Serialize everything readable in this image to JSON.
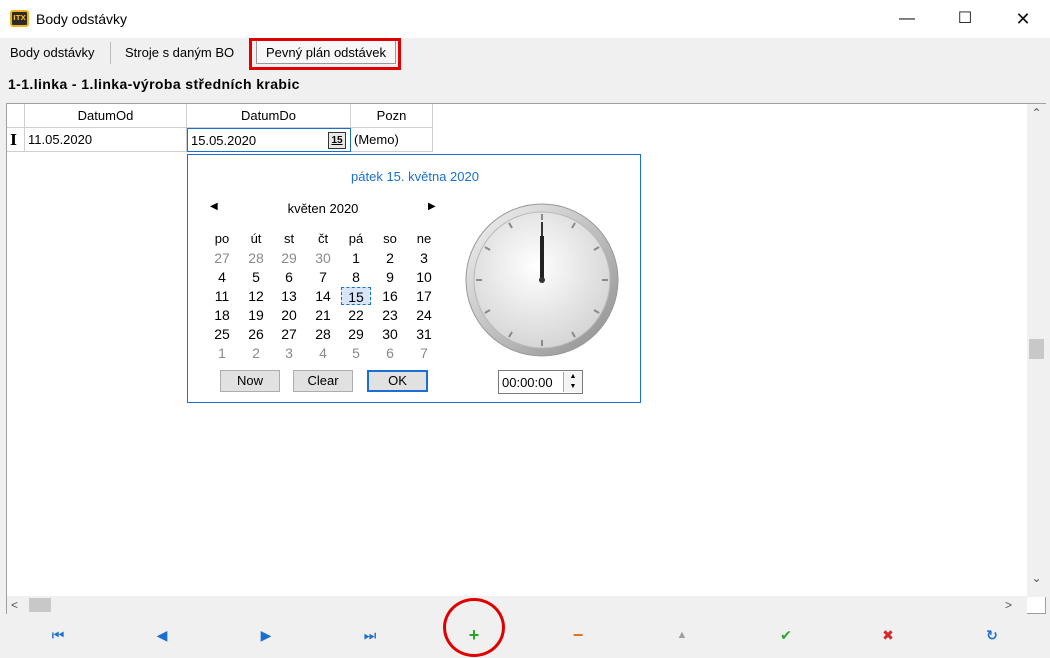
{
  "window": {
    "title": "Body odstávky",
    "minimize": "—",
    "maximize": "☐",
    "close": "✕"
  },
  "tabs": [
    {
      "label": "Body odstávky"
    },
    {
      "label": "Stroje s daným BO"
    },
    {
      "label": "Pevný plán odstávek"
    }
  ],
  "heading": "1-1.linka - 1.linka-výroba středních krabic",
  "grid": {
    "columns": [
      "DatumOd",
      "DatumDo",
      "Pozn"
    ],
    "rows": [
      {
        "indicator": "I",
        "datum_od": "11.05.2020",
        "datum_do": "15.05.2020",
        "pozn": "(Memo)"
      }
    ],
    "calendar_button": "15"
  },
  "calendar": {
    "selected_long": "pátek 15. května 2020",
    "month_title": "květen 2020",
    "prev": "◀",
    "next": "▶",
    "weekdays": [
      "po",
      "út",
      "st",
      "čt",
      "pá",
      "so",
      "ne"
    ],
    "weeks": [
      [
        "27",
        "28",
        "29",
        "30",
        "1",
        "2",
        "3"
      ],
      [
        "4",
        "5",
        "6",
        "7",
        "8",
        "9",
        "10"
      ],
      [
        "11",
        "12",
        "13",
        "14",
        "15",
        "16",
        "17"
      ],
      [
        "18",
        "19",
        "20",
        "21",
        "22",
        "23",
        "24"
      ],
      [
        "25",
        "26",
        "27",
        "28",
        "29",
        "30",
        "31"
      ],
      [
        "1",
        "2",
        "3",
        "4",
        "5",
        "6",
        "7"
      ]
    ],
    "other_month": [
      [
        0,
        0
      ],
      [
        0,
        1
      ],
      [
        0,
        2
      ],
      [
        0,
        3
      ],
      [
        5,
        0
      ],
      [
        5,
        1
      ],
      [
        5,
        2
      ],
      [
        5,
        3
      ],
      [
        5,
        4
      ],
      [
        5,
        5
      ],
      [
        5,
        6
      ]
    ],
    "selected": [
      2,
      4
    ],
    "buttons": {
      "now": "Now",
      "clear": "Clear",
      "ok": "OK"
    },
    "time": "00:00:00"
  },
  "navigator": {
    "first": "⏮",
    "prev": "◀",
    "next": "▶",
    "last": "⏭",
    "add": "+",
    "delete": "−",
    "edit": "▲",
    "post": "✔",
    "cancel": "✖",
    "refresh": "↻"
  },
  "colors": {
    "accent": "#1a6fd1",
    "highlight": "#e00000",
    "add": "#2aa52a",
    "delete": "#e0741a",
    "cancel": "#d62828"
  }
}
